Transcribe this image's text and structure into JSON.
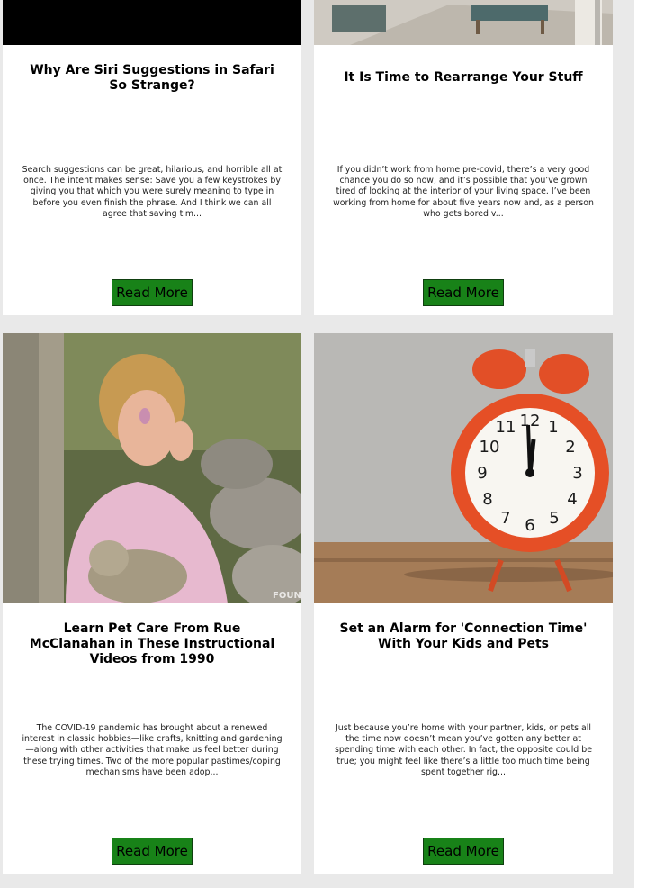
{
  "cards": [
    {
      "title": "Why Are Siri Suggestions in Safari So Strange?",
      "excerpt": "Search suggestions can be great, hilarious, and horrible all at once. The intent makes sense: Save you a few keystrokes by giving you that which you were surely meaning to type in before you even finish the phrase. And I think we can all agree that saving tim...",
      "button": "Read More"
    },
    {
      "title": "It Is Time to Rearrange Your Stuff",
      "excerpt": "If you didn’t work from home pre-covid, there’s a very good chance you do so now, and it’s possible that you’ve grown tired of looking at the interior of your living space. I’ve been working from home for about five years now and, as a person who gets bored v...",
      "button": "Read More"
    },
    {
      "title": "Learn Pet Care From Rue McClanahan in These Instructional Videos from 1990",
      "excerpt": "The COVID-19 pandemic has brought about a renewed interest in classic hobbies—like crafts, knitting and gardening—along with other activities that make us feel better during these trying times. Two of the more popular pastimes/coping mechanisms have been adop...",
      "button": "Read More",
      "watermark": "FOUND"
    },
    {
      "title": "Set an Alarm for 'Connection Time' With Your Kids and Pets",
      "excerpt": "Just because you’re home with your partner, kids, or pets all the time now doesn’t mean you’ve gotten any better at spending time with each other. In fact, the opposite could be true; you might feel like there’s a little too much time being spent together rig...",
      "button": "Read More"
    }
  ],
  "colors": {
    "page_bg": "#e9e9e9",
    "card_bg": "#ffffff",
    "button_bg": "#188218"
  }
}
